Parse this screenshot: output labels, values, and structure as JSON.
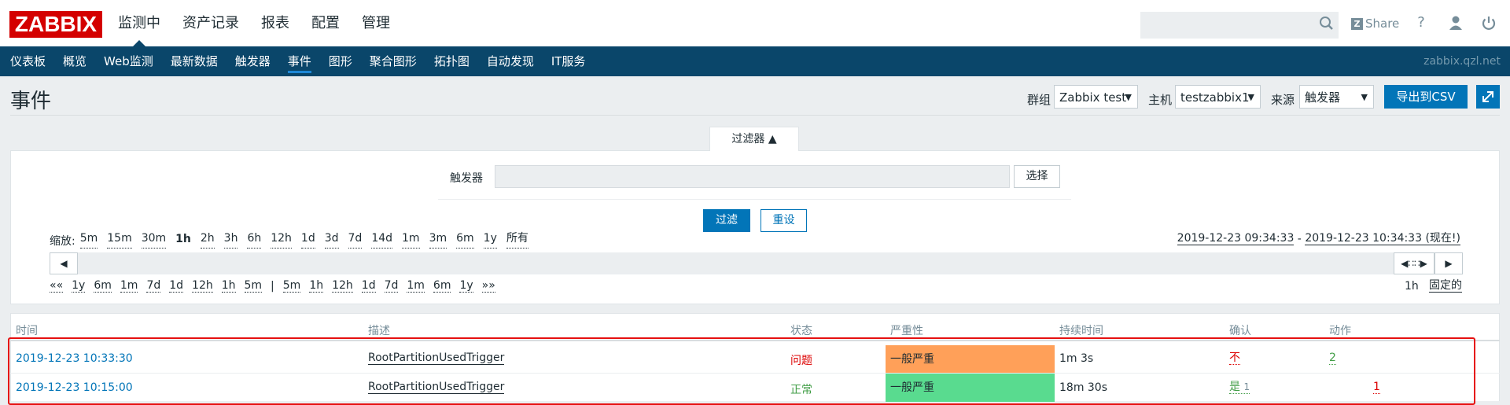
{
  "logo": "ZABBIX",
  "topnav": [
    "监测中",
    "资产记录",
    "报表",
    "配置",
    "管理"
  ],
  "header_icons": {
    "share_label": "Share",
    "help": "?",
    "user": "user-icon",
    "power": "power-icon"
  },
  "subnav": [
    "仪表板",
    "概览",
    "Web监测",
    "最新数据",
    "触发器",
    "事件",
    "图形",
    "聚合图形",
    "拓扑图",
    "自动发现",
    "IT服务"
  ],
  "server_name": "zabbix.qzl.net",
  "page": {
    "title": "事件",
    "group_label": "群组",
    "group_value": "Zabbix test",
    "host_label": "主机",
    "host_value": "testzabbix1",
    "source_label": "来源",
    "source_value": "触发器",
    "export_label": "导出到CSV"
  },
  "filter": {
    "tab_label": "过滤器 ▲",
    "trigger_label": "触发器",
    "select_label": "选择",
    "apply_label": "过滤",
    "reset_label": "重设"
  },
  "zoom": {
    "label": "缩放:",
    "options": [
      "5m",
      "15m",
      "30m",
      "1h",
      "2h",
      "3h",
      "6h",
      "12h",
      "1d",
      "3d",
      "7d",
      "14d",
      "1m",
      "3m",
      "6m",
      "1y",
      "所有"
    ],
    "active": "1h"
  },
  "period": {
    "start": "2019-12-23 09:34:33",
    "separator": " - ",
    "end": "2019-12-23 10:34:33 (现在!)"
  },
  "nav": {
    "back": [
      "««",
      "1y",
      "6m",
      "1m",
      "7d",
      "1d",
      "12h",
      "1h",
      "5m"
    ],
    "sep": "|",
    "forward": [
      "5m",
      "1h",
      "12h",
      "1d",
      "7d",
      "1m",
      "6m",
      "1y",
      "»»"
    ],
    "period_len": "1h",
    "fixed_label": "固定的"
  },
  "table": {
    "headers": [
      "时间",
      "描述",
      "状态",
      "严重性",
      "持续时间",
      "确认",
      "动作"
    ],
    "rows": [
      {
        "time": "2019-12-23 10:33:30",
        "desc": "RootPartitionUsedTrigger",
        "status": "问题",
        "severity": "一般严重",
        "duration": "1m 3s",
        "ack": "不",
        "actions": "2"
      },
      {
        "time": "2019-12-23 10:15:00",
        "desc": "RootPartitionUsedTrigger",
        "status": "正常",
        "severity": "一般严重",
        "duration": "18m 30s",
        "ack": "是",
        "ack_count": "1",
        "actions": "1"
      }
    ]
  },
  "colors": {
    "header_bg": "#0a466a",
    "problem_red": "#dc0000",
    "ok_green": "#429e47",
    "severity_average": "#ffa059",
    "severity_resolved": "#59db8f",
    "link_blue": "#0275b8",
    "highlight_box": "#e61010"
  }
}
